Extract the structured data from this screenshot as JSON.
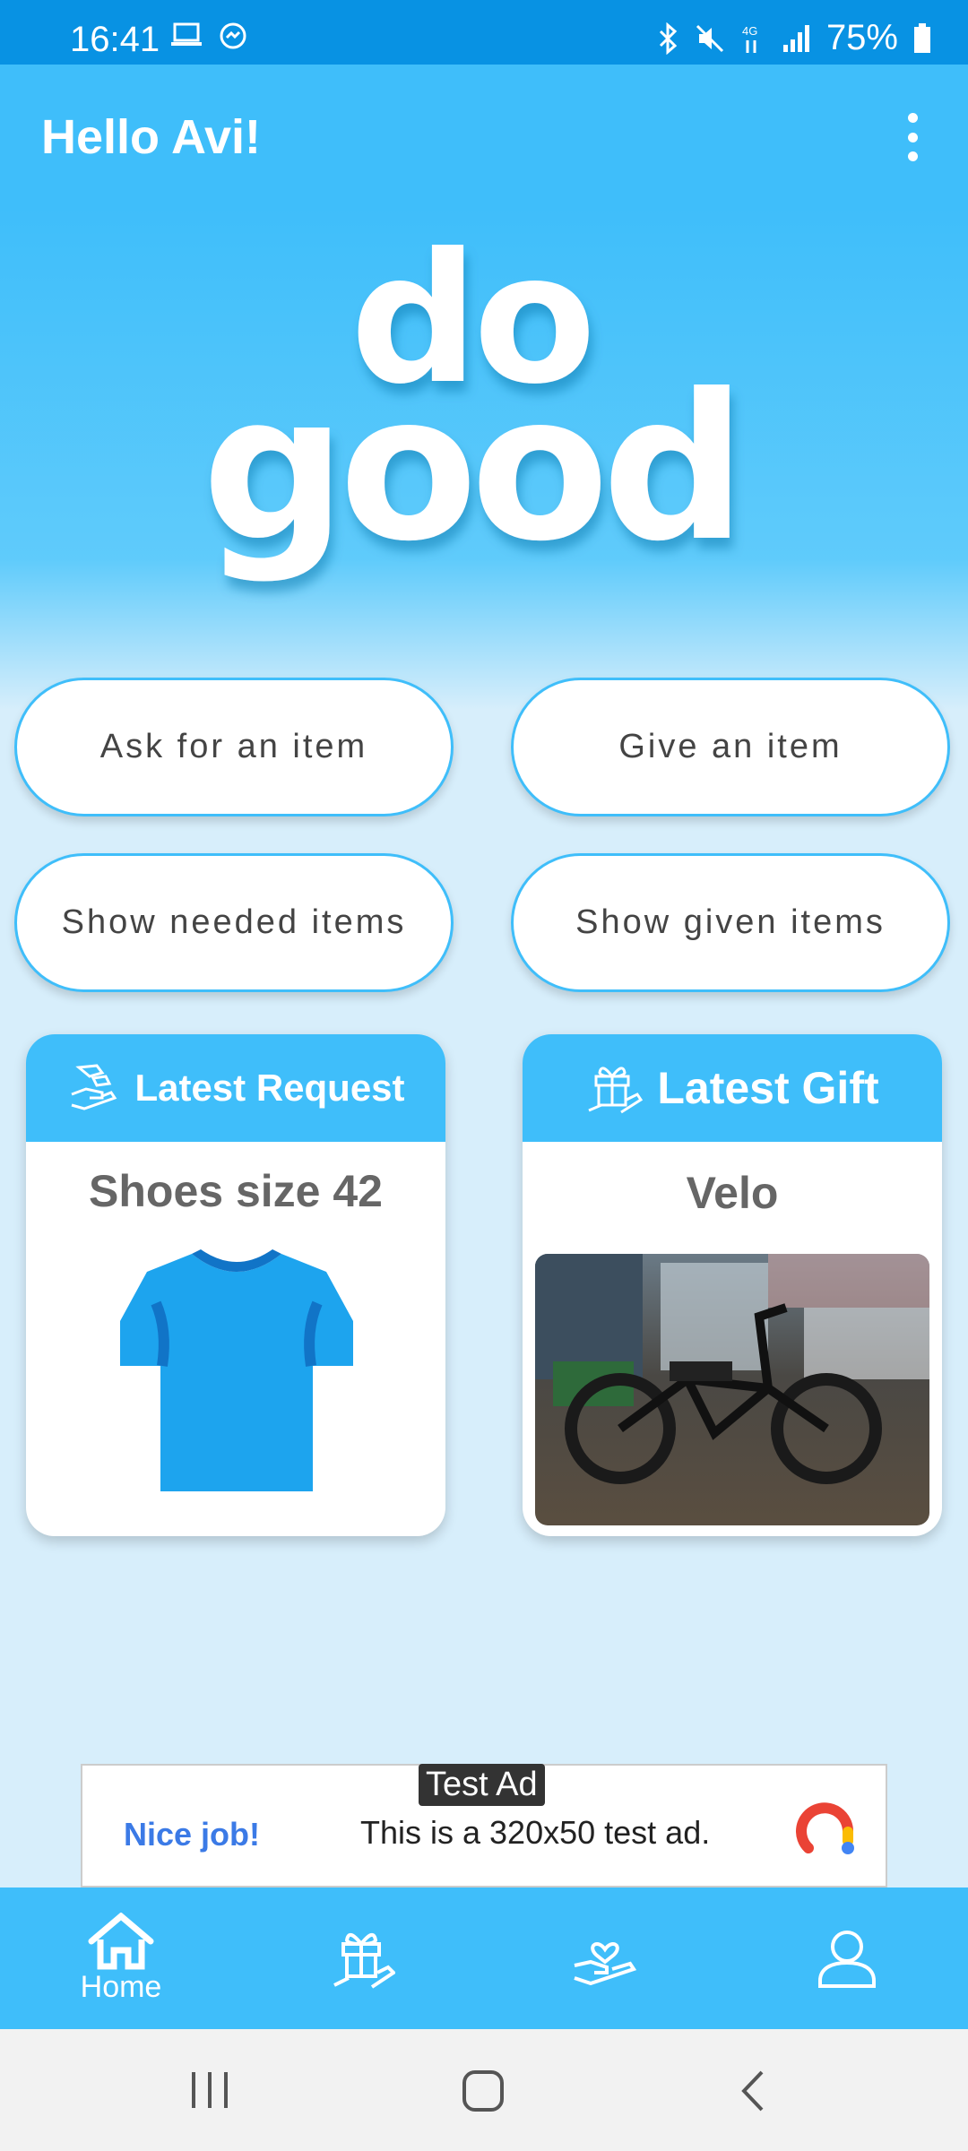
{
  "status_bar": {
    "time": "16:41",
    "battery": "75%"
  },
  "app_bar": {
    "title": "Hello Avi!",
    "menu_icon": "more-vert-icon"
  },
  "logo": {
    "line1": "do",
    "line2": "good"
  },
  "actions": {
    "ask": "Ask for an item",
    "give": "Give an item",
    "show_needed": "Show needed items",
    "show_given": "Show given items"
  },
  "latest_request": {
    "header": "Latest Request",
    "title": "Shoes size 42",
    "icon": "hand-receive-icon",
    "image": "blue-tshirt-illustration"
  },
  "latest_gift": {
    "header": "Latest Gift",
    "title": "Velo",
    "icon": "gift-hand-icon",
    "image": "electric-bicycle-photo"
  },
  "ad": {
    "tag": "Test Ad",
    "nice": "Nice job!",
    "message": "This is a 320x50 test ad."
  },
  "bottom_nav": {
    "items": [
      {
        "label": "Home",
        "icon": "home-icon",
        "active": true
      },
      {
        "label": "",
        "icon": "gift-hand-icon",
        "active": false
      },
      {
        "label": "",
        "icon": "heart-hand-icon",
        "active": false
      },
      {
        "label": "",
        "icon": "person-icon",
        "active": false
      }
    ]
  },
  "colors": {
    "primary": "#3fbefa",
    "status_bar": "#0892e3",
    "background": "#d7eefb"
  }
}
